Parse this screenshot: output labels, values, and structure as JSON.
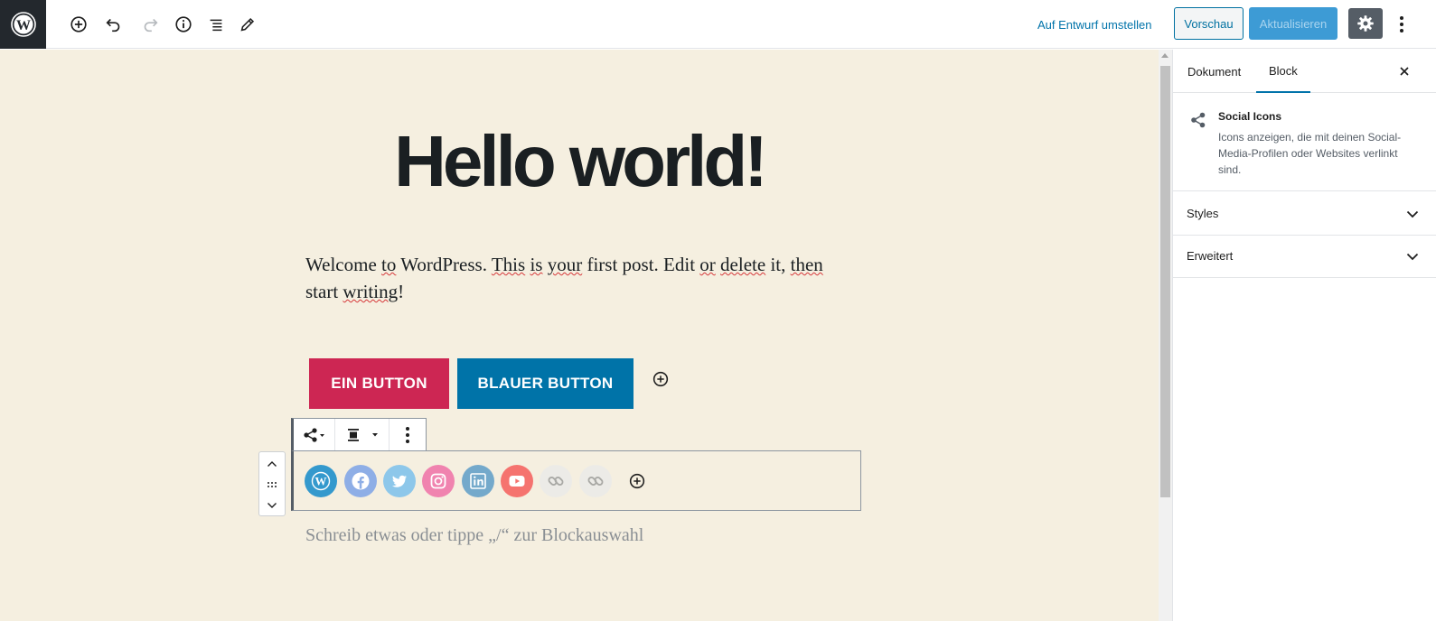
{
  "topbar": {
    "switch_to_draft_label": "Auf Entwurf umstellen",
    "preview_label": "Vorschau",
    "update_label": "Aktualisieren",
    "icons": [
      "wordpress-logo-icon",
      "add-block-icon",
      "undo-icon",
      "redo-icon",
      "info-icon",
      "outline-icon",
      "edit-icon",
      "gear-icon",
      "more-vertical-icon"
    ]
  },
  "post": {
    "title": "Hello world!",
    "para_segments": [
      "Welcome ",
      "to",
      " WordPress. ",
      "This",
      " ",
      "is",
      " ",
      "your",
      " first post. Edit ",
      "or",
      " ",
      "delete",
      " it, ",
      "then",
      " start ",
      "writing",
      "!"
    ],
    "placeholder": "Schreib etwas oder tippe „/“ zur Blockauswahl"
  },
  "buttons_block": {
    "red_label": "EIN BUTTON",
    "blue_label": "BLAUER BUTTON",
    "colors": {
      "red": "#cd2653",
      "blue": "#0073a8"
    }
  },
  "social_block": {
    "icons": [
      {
        "name": "wordpress-icon",
        "color": "#3499cd"
      },
      {
        "name": "facebook-icon",
        "color": "#8eaee6"
      },
      {
        "name": "twitter-icon",
        "color": "#8dc7ea"
      },
      {
        "name": "instagram-icon",
        "color": "#f083af"
      },
      {
        "name": "linkedin-icon",
        "color": "#74a9cb"
      },
      {
        "name": "youtube-icon",
        "color": "#f5736f"
      },
      {
        "name": "link-icon",
        "color": "#ecebe7"
      },
      {
        "name": "link-icon",
        "color": "#ecebe7"
      }
    ]
  },
  "sidebar": {
    "tabs": [
      "Dokument",
      "Block"
    ],
    "active_tab": "Block",
    "block_title": "Social Icons",
    "block_description": "Icons anzeigen, die mit deinen Social-Media-Profilen oder Websites verlinkt sind.",
    "panels": [
      "Styles",
      "Erweitert"
    ]
  },
  "colors": {
    "editor_bg": "#f5efe0",
    "accent": "#0073aa",
    "topbar_dark": "#23282d"
  }
}
